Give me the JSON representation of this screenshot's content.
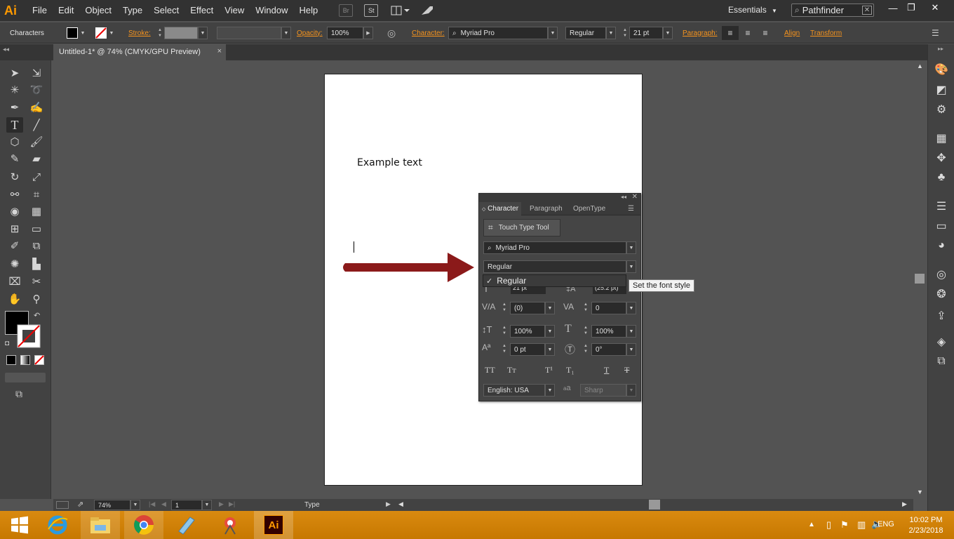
{
  "app": {
    "logo": "Ai",
    "workspace": "Essentials",
    "search_value": "Pathfinder"
  },
  "menu": [
    "File",
    "Edit",
    "Object",
    "Type",
    "Select",
    "Effect",
    "View",
    "Window",
    "Help"
  ],
  "menu_icons": {
    "bridge": "Br",
    "stock": "St"
  },
  "controlbar": {
    "title": "Characters",
    "stroke_label": "Stroke:",
    "opacity_label": "Opacity:",
    "opacity_value": "100%",
    "character_label": "Character:",
    "font_family": "Myriad Pro",
    "font_style": "Regular",
    "font_size": "21 pt",
    "paragraph_label": "Paragraph:",
    "align_label": "Align",
    "transform_label": "Transform"
  },
  "document_tab": {
    "title": "Untitled-1* @ 74% (CMYK/GPU Preview)",
    "close": "×"
  },
  "artboard": {
    "text": "Example text"
  },
  "character_panel": {
    "tabs": [
      "Character",
      "Paragraph",
      "OpenType"
    ],
    "touch_type": "Touch Type Tool",
    "font_family": "Myriad Pro",
    "font_style": "Regular",
    "font_size": "21 pt",
    "leading": "(25.2 pt)",
    "kerning": "(0)",
    "tracking": "0",
    "vertical_scale": "100%",
    "horizontal_scale": "100%",
    "baseline_shift": "0 pt",
    "rotation": "0°",
    "language": "English: USA",
    "antialias": "Sharp",
    "antialias_icon": "a",
    "antialias_icon_big": "a"
  },
  "style_dropdown": {
    "checked_option": "Regular",
    "check": "✓"
  },
  "tooltip": "Set the font style",
  "annotation": {
    "arrow_color": "#8b1a1a"
  },
  "statusbar": {
    "zoom": "74%",
    "page": "1",
    "tool": "Type"
  },
  "taskbar": {
    "language": "ENG",
    "time": "10:02 PM",
    "date": "2/23/2018",
    "ai_label": "Ai"
  }
}
